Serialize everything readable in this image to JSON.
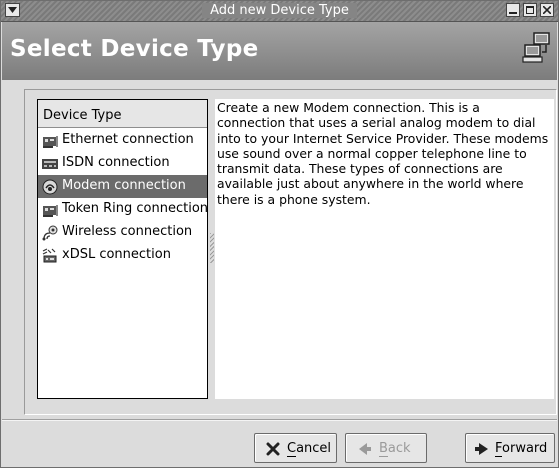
{
  "window": {
    "title": "Add new Device Type"
  },
  "banner": {
    "heading": "Select Device Type"
  },
  "device_list": {
    "header": "Device Type",
    "items": [
      {
        "label": "Ethernet connection",
        "icon": "ethernet-card-icon"
      },
      {
        "label": "ISDN connection",
        "icon": "isdn-card-icon"
      },
      {
        "label": "Modem connection",
        "icon": "modem-icon",
        "selected": true
      },
      {
        "label": "Token Ring connection",
        "icon": "token-ring-card-icon"
      },
      {
        "label": "Wireless connection",
        "icon": "wireless-icon"
      },
      {
        "label": "xDSL connection",
        "icon": "xdsl-icon"
      }
    ]
  },
  "description": "Create a new Modem connection.  This is a connection that uses a serial analog modem to dial into to your Internet Service Provider. These modems use sound over a normal copper telephone line to transmit data.  These types of connections are available just about anywhere in the world where there is a phone system.",
  "buttons": {
    "cancel": {
      "mnemonic": "C",
      "rest": "ancel"
    },
    "back": {
      "mnemonic": "B",
      "rest": "ack",
      "disabled": true
    },
    "forward": {
      "mnemonic": "F",
      "rest": "orward"
    }
  },
  "colors": {
    "selection": "#6b6b6b",
    "window_bg": "#dcdcdc",
    "banner_top": "#a4a4a4",
    "banner_bottom": "#7c7c7c"
  }
}
